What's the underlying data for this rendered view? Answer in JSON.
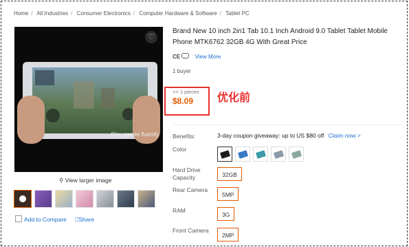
{
  "breadcrumb": [
    "Home",
    "All Industries",
    "Consumer Electronics",
    "Computer Hardware & Software",
    "Tablet PC"
  ],
  "breadcrumb_separator": "/",
  "media": {
    "video_caption": "Play games fluently",
    "view_larger": "View larger image"
  },
  "actions": {
    "add_to_compare": "Add to Compare",
    "share": "Share"
  },
  "product": {
    "title": "Brand New 10 inch 2in1 Tab 10.1 Inch Android 9.0 Tablet Tablet Mobile Phone MTK6762 32GB 4G With Great Price",
    "certs": "CE",
    "view_more": "View More",
    "buyers": "1 buyer",
    "pieces": ">= 1 pieces",
    "price": "$8.09",
    "annotation": "优化前"
  },
  "attributes": {
    "benefits_label": "Benefits:",
    "benefits_text": "3-day coupon giveaway: up to US $80 off",
    "claim": "Claim now >",
    "color_label": "Color",
    "hard_drive_label": "Hard Drive Capacity",
    "hard_drive_value": "32GB",
    "rear_camera_label": "Rear Camera",
    "rear_camera_value": "5MP",
    "ram_label": "RAM",
    "ram_value": "3G",
    "front_camera_label": "Front Camera",
    "front_camera_value": "2MP"
  },
  "colors": {
    "accent": "#e15a00",
    "link": "#1a6fcf",
    "annotation_red": "#e8322e"
  }
}
